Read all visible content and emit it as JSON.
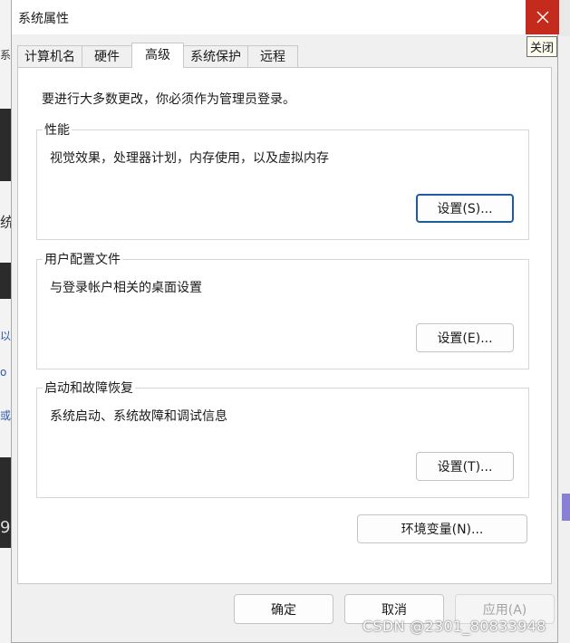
{
  "window": {
    "title": "系统属性",
    "close_tooltip": "关闭"
  },
  "tabs": [
    {
      "label": "计算机名",
      "active": false
    },
    {
      "label": "硬件",
      "active": false
    },
    {
      "label": "高级",
      "active": true
    },
    {
      "label": "系统保护",
      "active": false
    },
    {
      "label": "远程",
      "active": false
    }
  ],
  "panel": {
    "notice": "要进行大多数更改，你必须作为管理员登录。",
    "groups": [
      {
        "title": "性能",
        "description": "视觉效果，处理器计划，内存使用，以及虚拟内存",
        "button": "设置(S)..."
      },
      {
        "title": "用户配置文件",
        "description": "与登录帐户相关的桌面设置",
        "button": "设置(E)..."
      },
      {
        "title": "启动和故障恢复",
        "description": "系统启动、系统故障和调试信息",
        "button": "设置(T)..."
      }
    ],
    "env_button": "环境变量(N)..."
  },
  "footer": {
    "ok": "确定",
    "cancel": "取消",
    "apply": "应用(A)"
  },
  "background": {
    "left_glyphs": [
      "系",
      "统",
      "以",
      "o",
      "或",
      "9"
    ],
    "watermark": "CSDN @2301_80833948"
  },
  "colors": {
    "close_red": "#c42b1c",
    "focus_blue": "#1d5ba3"
  }
}
